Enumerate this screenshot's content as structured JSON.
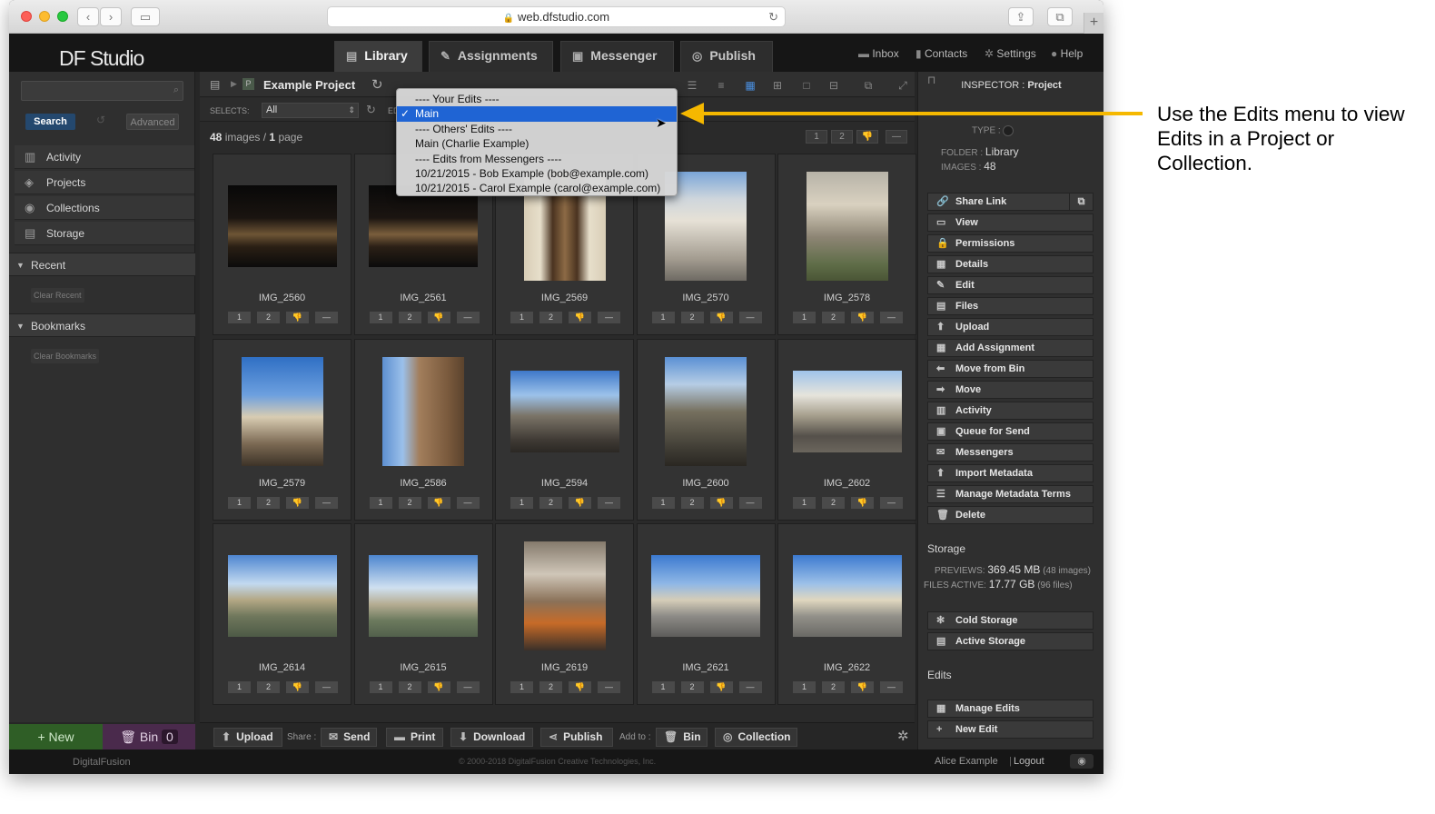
{
  "browser": {
    "url": "web.dfstudio.com"
  },
  "app": {
    "logo": "DF Studio",
    "tabs": [
      {
        "label": "Library",
        "icon": "library-icon"
      },
      {
        "label": "Assignments",
        "icon": "assignments-icon"
      },
      {
        "label": "Messenger",
        "icon": "messenger-icon"
      },
      {
        "label": "Publish",
        "icon": "publish-icon"
      }
    ],
    "toplinks": [
      "Inbox",
      "Contacts",
      "Settings",
      "Help"
    ]
  },
  "sidebar": {
    "search_button": "Search",
    "advanced_button": "Advanced",
    "items": [
      "Activity",
      "Projects",
      "Collections",
      "Storage"
    ],
    "recent": {
      "label": "Recent",
      "clear": "Clear Recent"
    },
    "bookmarks": {
      "label": "Bookmarks",
      "clear": "Clear Bookmarks"
    },
    "new_button": "+ New",
    "bin_label": "Bin",
    "bin_count": "0"
  },
  "main": {
    "project_title": "Example Project",
    "selects_label": "SELECTS:",
    "selects_value": "All",
    "edits_label": "EDIT",
    "image_count": "48",
    "images_word": "images",
    "page_count": "1",
    "page_word": "page",
    "rating_labels": [
      "1",
      "2",
      "👎",
      "—"
    ],
    "images": [
      "IMG_2560",
      "IMG_2561",
      "IMG_2569",
      "IMG_2570",
      "IMG_2578",
      "IMG_2579",
      "IMG_2586",
      "IMG_2594",
      "IMG_2600",
      "IMG_2602",
      "IMG_2614",
      "IMG_2615",
      "IMG_2619",
      "IMG_2621",
      "IMG_2622"
    ]
  },
  "bottombar": {
    "upload": "Upload",
    "share_label": "Share :",
    "send": "Send",
    "print": "Print",
    "download": "Download",
    "publish": "Publish",
    "addto_label": "Add to :",
    "bin": "Bin",
    "collection": "Collection"
  },
  "inspector": {
    "title_prefix": "INSPECTOR :",
    "title_type": "Project",
    "type_label": "TYPE :",
    "folder_label": "FOLDER :",
    "folder_value": "Library",
    "images_label": "IMAGES :",
    "images_value": "48",
    "actions": [
      "Share Link",
      "View",
      "Permissions",
      "Details",
      "Edit",
      "Files",
      "Upload",
      "Add Assignment",
      "Move from Bin",
      "Move",
      "Activity",
      "Queue for Send",
      "Messengers",
      "Import Metadata",
      "Manage Metadata Terms",
      "Delete"
    ],
    "storage_heading": "Storage",
    "previews_label": "PREVIEWS:",
    "previews_value": "369.45 MB",
    "previews_note": "(48 images)",
    "files_label": "FILES ACTIVE:",
    "files_value": "17.77 GB",
    "files_note": "(96 files)",
    "storage_actions": [
      "Cold Storage",
      "Active Storage"
    ],
    "edits_heading": "Edits",
    "edits_actions": [
      "Manage Edits",
      "New Edit"
    ]
  },
  "footer": {
    "brand": "DigitalFusion",
    "copyright": "© 2000-2018 DigitalFusion Creative Technologies, Inc.",
    "user": "Alice Example",
    "logout": "Logout"
  },
  "edits_menu": {
    "items": [
      {
        "label": "---- Your Edits ----",
        "selected": false
      },
      {
        "label": "Main",
        "selected": true
      },
      {
        "label": "---- Others' Edits ----",
        "selected": false
      },
      {
        "label": "Main (Charlie Example)",
        "selected": false
      },
      {
        "label": "---- Edits from Messengers ----",
        "selected": false
      },
      {
        "label": "10/21/2015 - Bob Example (bob@example.com)",
        "selected": false
      },
      {
        "label": "10/21/2015 - Carol Example (carol@example.com)",
        "selected": false
      }
    ],
    "check": "✓"
  },
  "annotation": "Use the Edits menu to view Edits in a Project or Collection.",
  "colors": {
    "accent_arrow": "#f5b800",
    "menu_highlight": "#1f64d4",
    "new_button": "#2f5e26",
    "bin_button": "#4a2a4c"
  }
}
